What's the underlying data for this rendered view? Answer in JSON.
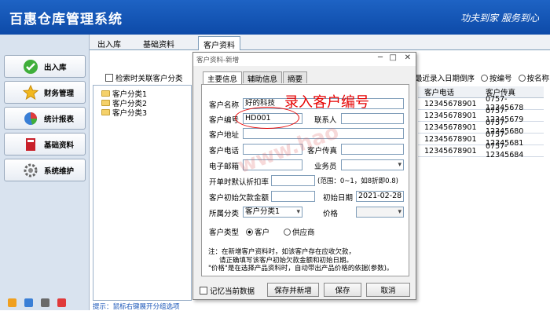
{
  "app": {
    "title": "百惠仓库管理系统",
    "slogan": "功夫到家 服务到心"
  },
  "sidebar": {
    "items": [
      {
        "label": "出入库",
        "icon": "check-icon"
      },
      {
        "label": "财务管理",
        "icon": "star-icon"
      },
      {
        "label": "统计报表",
        "icon": "pie-chart-icon"
      },
      {
        "label": "基础资料",
        "icon": "book-icon"
      },
      {
        "label": "系统维护",
        "icon": "gear-icon"
      }
    ]
  },
  "tabs": [
    "出入库",
    "基础资料",
    "客户资料"
  ],
  "background": {
    "link_checkbox": "检索时关联客户分类",
    "tree": [
      "客户分类1",
      "客户分类2",
      "客户分类3"
    ],
    "status_hint": "提示：鼠标右键展开分组选项",
    "sort_options": [
      "最近录入日期倒序",
      "按编号",
      "按名称"
    ],
    "grid": {
      "headers": [
        "客户电话",
        "客户传真"
      ],
      "rows": [
        [
          "12345678901",
          "0757-12345678"
        ],
        [
          "12345678901",
          "0757-12345679"
        ],
        [
          "12345678901",
          "0757-12345680"
        ],
        [
          "12345678901",
          "0757-12345681"
        ],
        [
          "12345678901",
          "0757-12345684"
        ]
      ]
    }
  },
  "dialog": {
    "title": "客户资料-新增",
    "tabs": [
      "主要信息",
      "辅助信息",
      "摘要"
    ],
    "fields": {
      "name_label": "客户名称",
      "name_value": "好的科技",
      "code_label": "客户编号",
      "code_value": "HD001",
      "contact_label": "联系人",
      "address_label": "客户地址",
      "phone_label": "客户电话",
      "fax_label": "客户传真",
      "email_label": "电子邮箱",
      "salesman_label": "业务员",
      "discount_label": "开单时默认折扣率",
      "discount_hint": "(范围：0~1，如8折即0.8)",
      "initial_debt_label": "客户初始欠款金额",
      "initial_date_label": "初始日期",
      "initial_date_value": "2021-02-28",
      "category_label": "所属分类",
      "category_value": "客户分类1",
      "price_label": "价格",
      "type_label": "客户类型",
      "type_customer": "客户",
      "type_supplier": "供应商"
    },
    "note": [
      "注：在新增客户资料时，如该客户存在应收欠款，",
      "请正确填写该客户初始欠款金额和初始日期。",
      "\"价格\"是在选择产品资料时，自动带出产品价格的依据(参数)。"
    ],
    "remember_label": "记忆当前数据",
    "buttons": {
      "save_new": "保存并新增",
      "save": "保存",
      "cancel": "取消"
    }
  },
  "annotation": "录入客户编号",
  "watermark": "www.hao",
  "colors": {
    "header": "#1459bd",
    "accent_red": "#e60000",
    "link_blue": "#1a56b8"
  }
}
